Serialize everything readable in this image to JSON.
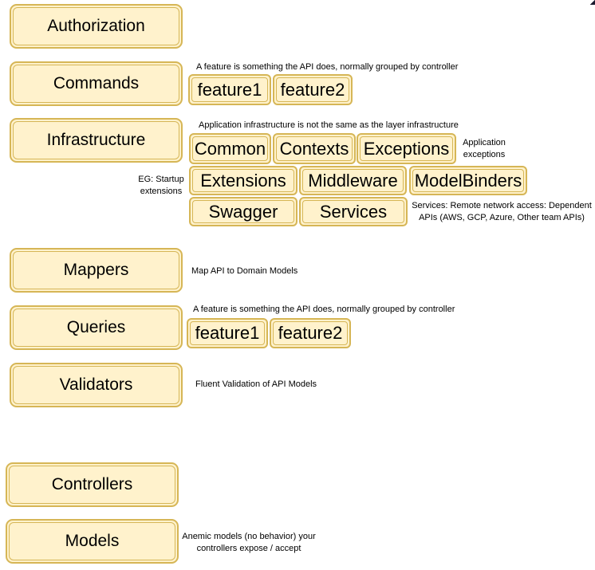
{
  "layers": [
    {
      "id": "authorization",
      "label": "Authorization"
    },
    {
      "id": "commands",
      "label": "Commands",
      "note": "A feature is something the API does, normally grouped by controller",
      "children": [
        "feature1",
        "feature2"
      ]
    },
    {
      "id": "infrastructure",
      "label": "Infrastructure",
      "note": "Application infrastructure is not the same as the layer infrastructure",
      "children": [
        "Common",
        "Contexts",
        "Exceptions",
        "Extensions",
        "Middleware",
        "ModelBinders",
        "Swagger",
        "Services"
      ],
      "annotations": {
        "exceptions": "Application exceptions",
        "extensions": "EG: Startup extensions",
        "services": "Services: Remote network access: Dependent APIs (AWS, GCP, Azure, Other team APIs)"
      }
    },
    {
      "id": "mappers",
      "label": "Mappers",
      "note": "Map API to Domain Models"
    },
    {
      "id": "queries",
      "label": "Queries",
      "note": "A feature is something the API does, normally grouped by controller",
      "children": [
        "feature1",
        "feature2"
      ]
    },
    {
      "id": "validators",
      "label": "Validators",
      "note": "Fluent Validation of API Models"
    },
    {
      "id": "controllers",
      "label": "Controllers"
    },
    {
      "id": "models",
      "label": "Models",
      "note": "Anemic models (no behavior) your controllers expose / accept"
    }
  ],
  "notes_split": {
    "exceptions_l1": "Application",
    "exceptions_l2": "exceptions",
    "extensions_l1": "EG: Startup",
    "extensions_l2": "extensions",
    "services_l1": "Services: Remote network access: Dependent",
    "services_l2": "APIs (AWS, GCP, Azure, Other team APIs)",
    "models_l1": "Anemic models (no behavior) your",
    "models_l2": "controllers expose / accept"
  },
  "colors": {
    "fill": "#fff2cc",
    "stroke": "#d6b656"
  }
}
